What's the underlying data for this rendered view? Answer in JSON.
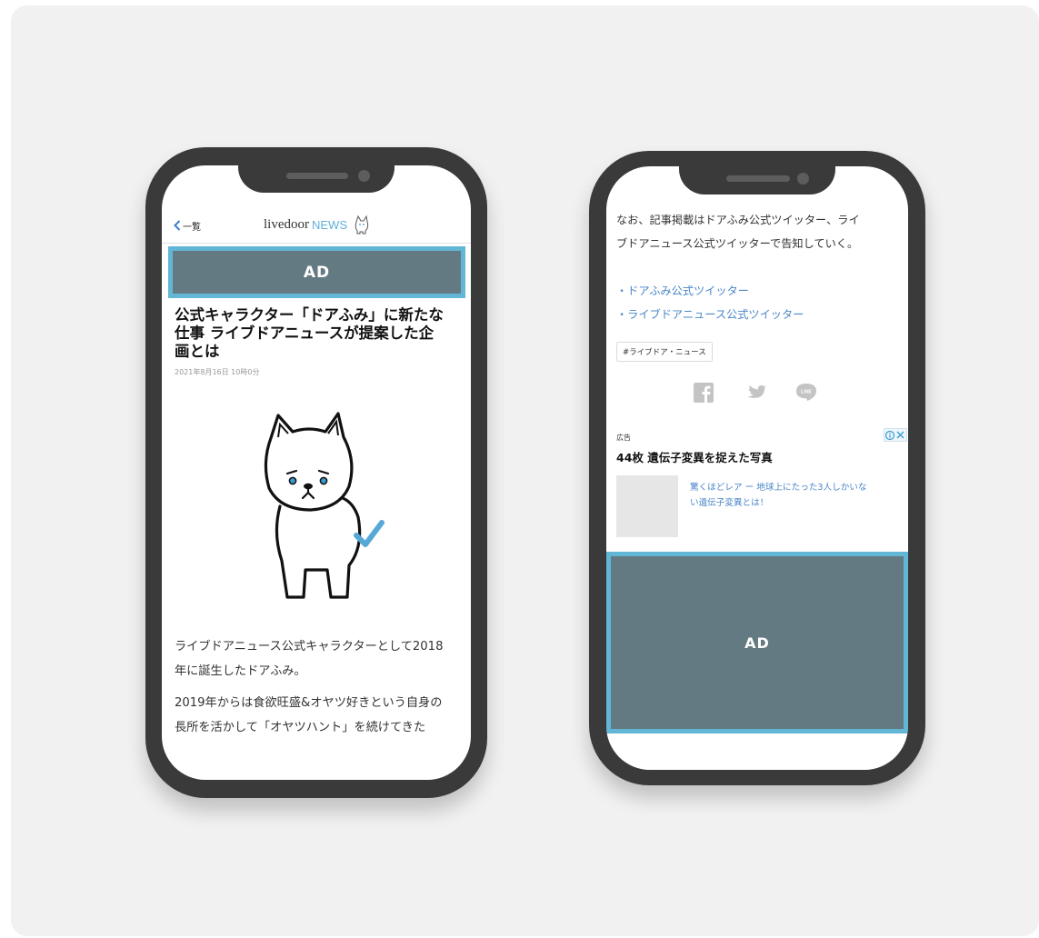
{
  "left_phone": {
    "nav": {
      "back_label": "一覧",
      "logo_wordmark": "livedoor",
      "logo_news": "NEWS"
    },
    "ad_label": "AD",
    "article": {
      "title_lines": [
        "公式キャラクター「ドアふみ」に新たな",
        "仕事 ライブドアニュースが提案した企",
        "画とは"
      ],
      "date": "2021年8月16日 10時0分",
      "para1_lines": [
        "ライブドアニュース公式キャラクターとして2018",
        "年に誕生したドアふみ。"
      ],
      "para2_lines": [
        "2019年からは食欲旺盛&オヤツ好きという自身の",
        "長所を活かして「オヤツハント」を続けてきた"
      ]
    }
  },
  "right_phone": {
    "notice_lines": [
      "なお、記事掲載はドアふみ公式ツイッター、ライ",
      "ブドアニュース公式ツイッターで告知していく。"
    ],
    "links": [
      "・ドアふみ公式ツイッター",
      "・ライブドアニュース公式ツイッター"
    ],
    "tag": "#ライブドア・ニュース",
    "share_icons": [
      "facebook-icon",
      "twitter-icon",
      "line-icon"
    ],
    "line_icon_text": "LINE",
    "sponsored": {
      "label": "広告",
      "title": "44枚 遺伝子変異を捉えた写真",
      "text_lines": [
        "驚くほどレア ー 地球上にたった3人しかいな",
        "い遺伝子変異とは！"
      ]
    },
    "ad_label": "AD"
  },
  "colors": {
    "ad_fill": "#647a82",
    "ad_border": "#62b6d6",
    "link": "#4a86c8",
    "phone_frame": "#3a3a3a",
    "check_mark": "#56a8d6"
  }
}
